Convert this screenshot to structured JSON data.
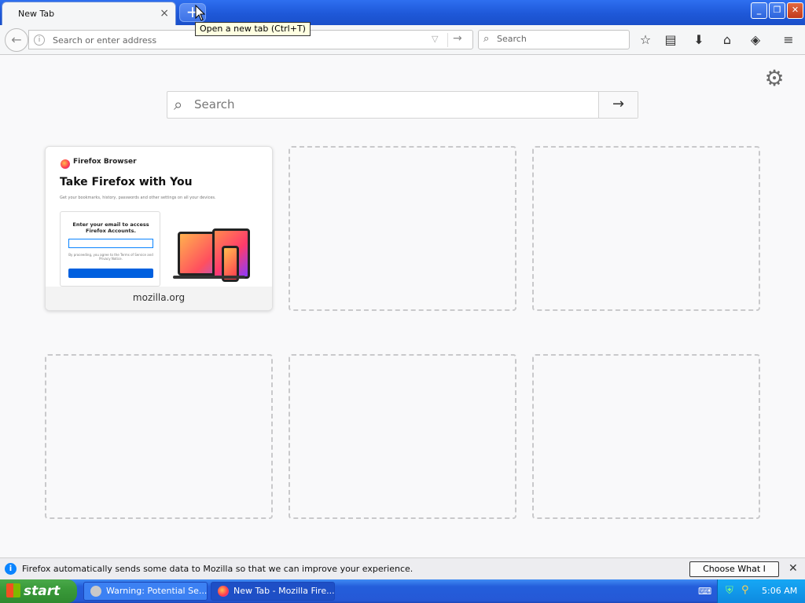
{
  "tabs": [
    {
      "title": "New Tab",
      "close": "×"
    }
  ],
  "new_tab": {
    "label": "+",
    "tooltip": "Open a new tab (Ctrl+T)"
  },
  "window_controls": {
    "minimize": "_",
    "restore": "❐",
    "close": "✕"
  },
  "navbar": {
    "back": "←",
    "url_placeholder": "Search or enter address",
    "url_dropdown": "▽",
    "url_go": "→",
    "search_placeholder": "Search"
  },
  "toolbar_icons": [
    "star-icon",
    "library-icon",
    "download-icon",
    "home-icon",
    "pocket-icon",
    "menu-icon"
  ],
  "toolbar_glyphs": {
    "star": "☆",
    "library": "▤",
    "download": "⬇",
    "home": "⌂",
    "pocket": "◈",
    "menu": "≡"
  },
  "page": {
    "settings_glyph": "⚙",
    "search_placeholder": "Search",
    "search_go": "→"
  },
  "top_sites": [
    {
      "label": "mozilla.org",
      "preview": {
        "brand": "Firefox Browser",
        "heading": "Take Firefox with You",
        "subtext": "Get your bookmarks, history, passwords and other settings on all your devices.",
        "card_title": "Enter your email to access Firefox Accounts.",
        "fine_print": "By proceeding, you agree to the Terms of Service and Privacy Notice."
      }
    },
    {
      "label": ""
    },
    {
      "label": ""
    },
    {
      "label": ""
    },
    {
      "label": ""
    },
    {
      "label": ""
    }
  ],
  "notification": {
    "icon": "i",
    "message": "Firefox automatically sends some data to Mozilla so that we can improve your experience.",
    "button": "Choose What I Share",
    "close": "✕"
  },
  "taskbar": {
    "start": "start",
    "tasks": [
      {
        "label": "Warning: Potential Se..."
      },
      {
        "label": "New Tab - Mozilla Fire..."
      }
    ],
    "clock": "5:06 AM"
  }
}
